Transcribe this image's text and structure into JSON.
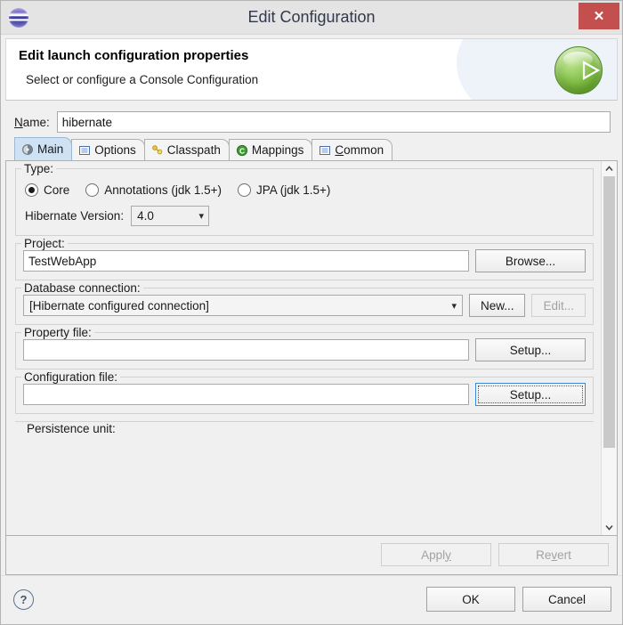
{
  "window": {
    "title": "Edit Configuration",
    "app_icon": "hibernate-sphere-icon",
    "close_label": "✕"
  },
  "banner": {
    "title": "Edit launch configuration properties",
    "subtitle": "Select or configure a Console Configuration",
    "icon": "green-run-play-icon"
  },
  "name_field": {
    "label": "Name:",
    "mnemonic": "N",
    "value": "hibernate",
    "placeholder": ""
  },
  "tabs": [
    {
      "label": "Main",
      "icon": "main-refresh-icon",
      "active": true
    },
    {
      "label": "Options",
      "icon": "options-list-icon",
      "active": false
    },
    {
      "label": "Classpath",
      "icon": "classpath-folder-icon",
      "active": false
    },
    {
      "label": "Mappings",
      "icon": "mappings-c-icon",
      "active": false
    },
    {
      "label": "Common",
      "icon": "common-list-icon",
      "active": false,
      "mnemonic": "C"
    }
  ],
  "type_group": {
    "legend": "Type:",
    "options": [
      {
        "label": "Core",
        "checked": true
      },
      {
        "label": "Annotations (jdk 1.5+)",
        "checked": false
      },
      {
        "label": "JPA (jdk 1.5+)",
        "checked": false
      }
    ],
    "version_label": "Hibernate Version:",
    "version_value": "4.0"
  },
  "project_group": {
    "legend": "Project:",
    "value": "TestWebApp",
    "button": "Browse..."
  },
  "database_group": {
    "legend": "Database connection:",
    "value": "[Hibernate configured connection]",
    "new_button": "New...",
    "edit_button": "Edit...",
    "edit_disabled": true
  },
  "property_file_group": {
    "legend": "Property file:",
    "value": "",
    "button": "Setup..."
  },
  "configuration_file_group": {
    "legend": "Configuration file:",
    "value": "",
    "button": "Setup...",
    "focused": true
  },
  "persistence_group": {
    "legend": "Persistence unit:"
  },
  "apply_row": {
    "apply": "Apply",
    "apply_mnemonic": "y",
    "revert": "Revert",
    "revert_mnemonic": "v",
    "apply_disabled": true,
    "revert_disabled": true
  },
  "footer": {
    "help_icon": "question-mark-icon",
    "help_glyph": "?",
    "ok": "OK",
    "cancel": "Cancel"
  },
  "scrollbar": {
    "up_glyph": "⌃",
    "down_glyph": "⌄"
  },
  "colors": {
    "close_red": "#c3504e",
    "tab_active": "#cfe2f3",
    "run_green": "#8dc653",
    "focus_blue": "#3a87d8"
  }
}
